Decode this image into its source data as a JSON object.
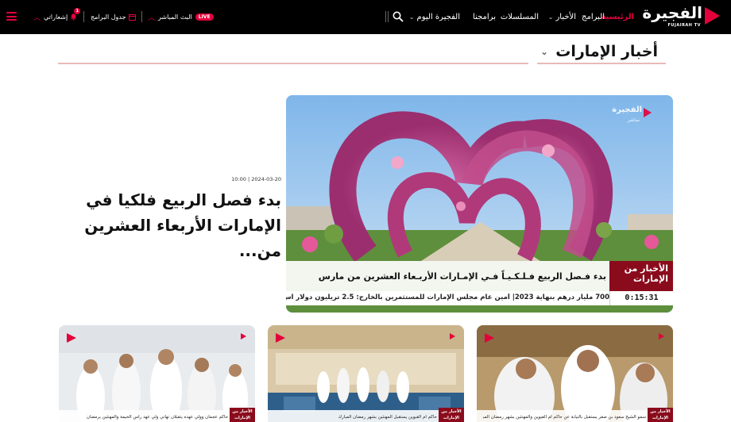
{
  "header": {
    "logo_ar": "الفجيرة",
    "logo_en": "FUJAIRAH TV",
    "nav": [
      {
        "label": "الرئيسية",
        "active": true,
        "dropdown": false
      },
      {
        "label": "البرامج",
        "active": false,
        "dropdown": false
      },
      {
        "label": "الأخبار",
        "active": false,
        "dropdown": true
      },
      {
        "label": "المسلسلات",
        "active": false,
        "dropdown": false
      },
      {
        "label": "برامجنا",
        "active": false,
        "dropdown": false
      },
      {
        "label": "الفجيرة اليوم",
        "active": false,
        "dropdown": true
      }
    ],
    "live_label": "البث المباشر",
    "live_badge": "LIVE",
    "schedule_label": "جدول البرامج",
    "notifications_label": "إشعاراتي",
    "notifications_count": "1",
    "accent_color": "#e3003b"
  },
  "section": {
    "title": "أخبار الإمارات"
  },
  "featured": {
    "date": "2024-03-20 | 10:00",
    "title": "بدء فصل الربيع فلكيا في الإمارات الأربعاء العشرين من...",
    "overlay_headline": "بدء فـصل الربيع فـلـكـيـاً فـي الإمـارات الأربـعاء العشرين من مارس",
    "overlay_ticker": "700 مليار درهم بنهاية 2023| أمين عام مجلس الإمارات للمستثمرين بالخارج: 2.5 تريليون دولار اس",
    "badge_line1": "الأخبار من",
    "badge_line2": "الإمارات",
    "duration": "0:15:31",
    "watermark_ar": "الفجيرة",
    "watermark_sub": "مباشر"
  },
  "cards": [
    {
      "caption": "سمو الشيخ سعود بن صقر يستقبل بالنيابة عن حاكم أم القيوين والمهنئين بشهر رمضان المبارك",
      "badge": "الأخبار من الإمارات"
    },
    {
      "caption": "حاكم أم القيوين يستقبل المهنئين بشهر رمضان المبارك",
      "badge": "الأخبار من الإمارات"
    },
    {
      "caption": "حاكم عجمان وولي عهده يتقبلان تهاني ولي عهد رأس الخيمة والمهنئين برمضان",
      "badge": "الأخبار من الإمارات"
    }
  ]
}
